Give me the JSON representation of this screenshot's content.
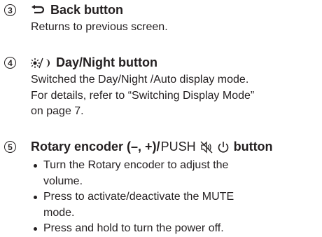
{
  "items": [
    {
      "number": "3",
      "icon": "return-arrow-icon",
      "title": "Back button",
      "description": [
        "Returns to previous screen."
      ]
    },
    {
      "number": "4",
      "icon": "sun-moon-icon",
      "title": "Day/Night button",
      "description": [
        "Switched the Day/Night /Auto display mode.",
        "For details, refer to “Switching Display Mode”",
        "on page 7."
      ]
    },
    {
      "number": "5",
      "title_a": "Rotary encoder (–, +)/",
      "title_push": "PUSH",
      "icons": [
        "mute-speaker-icon",
        "power-icon"
      ],
      "title_b": "button",
      "bullets": [
        "Turn the Rotary encoder to adjust the volume.",
        "Press to activate/deactivate the MUTE mode.",
        "Press and hold to turn the power off."
      ]
    }
  ]
}
